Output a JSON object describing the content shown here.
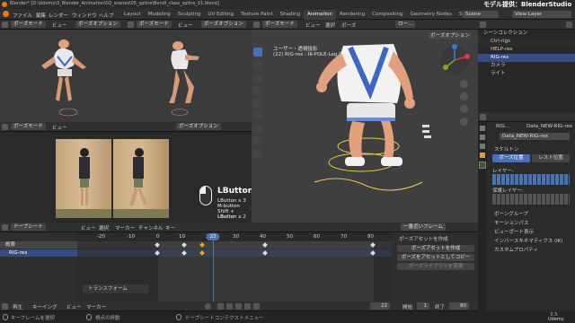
{
  "title_bar": {
    "text": "Blender* [D:\\Udemy\\3_Blender_Animation\\02_scenes\\05_spline\\Bendl_class_spline_01.blend]",
    "watermark": "モデル提供：BlenderStudio"
  },
  "menu": [
    "ファイル",
    "編集",
    "レンダー",
    "ウィンドウ",
    "ヘルプ"
  ],
  "workspaces": [
    "Layout",
    "Modeling",
    "Sculpting",
    "UV Editing",
    "Texture Paint",
    "Shading",
    "Animation",
    "Rendering",
    "Compositing",
    "Geometry Nodes",
    "Script"
  ],
  "active_workspace": "Animation",
  "scene_label": "Scene",
  "view_layer": "View Layer",
  "viewport_header": {
    "mode": "ポーズモード",
    "view": "ビュー",
    "select": "選択",
    "pose": "ポーズ",
    "options": "ポーズオプション",
    "local": "ロー..."
  },
  "main_viewport": {
    "title": "ユーザー・透視投影",
    "subtitle": "(22) RIG-rex : IK-POLE-Leg.R",
    "options": "ポーズオプション"
  },
  "video_panel": {
    "lbutton": "LButton",
    "lines": [
      "LButton x 3",
      "M-button",
      "Shift + LButton",
      "LButton x 2"
    ]
  },
  "outliner": {
    "header": "シーンコレクション",
    "items": [
      "Ctrl-rigs",
      "HELP-rex",
      "RIG-rex",
      "カメラ",
      "ライト"
    ]
  },
  "properties": {
    "breadcrumb_a": "RIG...",
    "breadcrumb_b": "Data_NEW-RIG-rex",
    "data_name": "Data_NEW-RIG-rex",
    "skeleton": "スケルトン",
    "pose_pos": "ポーズ位置",
    "rest_pos": "レスト位置",
    "layers": "レイヤー:",
    "protected_layers": "保護レイヤー:",
    "sections": [
      "ボーングループ",
      "モーションパス",
      "ビューポート表示",
      "インバースキネマティクス (IK)",
      "カスタムプロパティ"
    ]
  },
  "dopesheet": {
    "mode": "ドープシート",
    "menu": [
      "ビュー",
      "選択",
      "マーカー",
      "チャンネル",
      "キー"
    ],
    "interp": "一番近いフレーム",
    "ticks": [
      "-20",
      "-10",
      "0",
      "10",
      "20",
      "30",
      "40",
      "50",
      "60",
      "70",
      "80"
    ],
    "current_frame": "22",
    "channels": [
      "概要",
      "RIG-rex"
    ],
    "transform": "トランスフォーム",
    "pose_asset_title": "ポーズアセットを作成",
    "pose_asset_btn1": "ポーズアセットを作成",
    "pose_asset_btn2": "ポーズをアセットとしてコピー",
    "pose_asset_btn3": "ポーズライブラリを変換"
  },
  "playback": {
    "play": "再生",
    "keying": "キーイング",
    "view": "ビュー",
    "marker": "マーカー",
    "frame": "22",
    "start_label": "開始",
    "start": "1",
    "end_label": "終了",
    "end": "80"
  },
  "status_bar": {
    "left": "キーフレームを選択",
    "mid": "視点の移動",
    "right": "ドープシートコンテクストメニュー",
    "version": "3.5"
  },
  "udemy": "Udemy",
  "colors": {
    "accent": "#4772b3",
    "playhead": "#4772b3",
    "selection": "#334d80",
    "key_selected": "#f3a42a"
  }
}
